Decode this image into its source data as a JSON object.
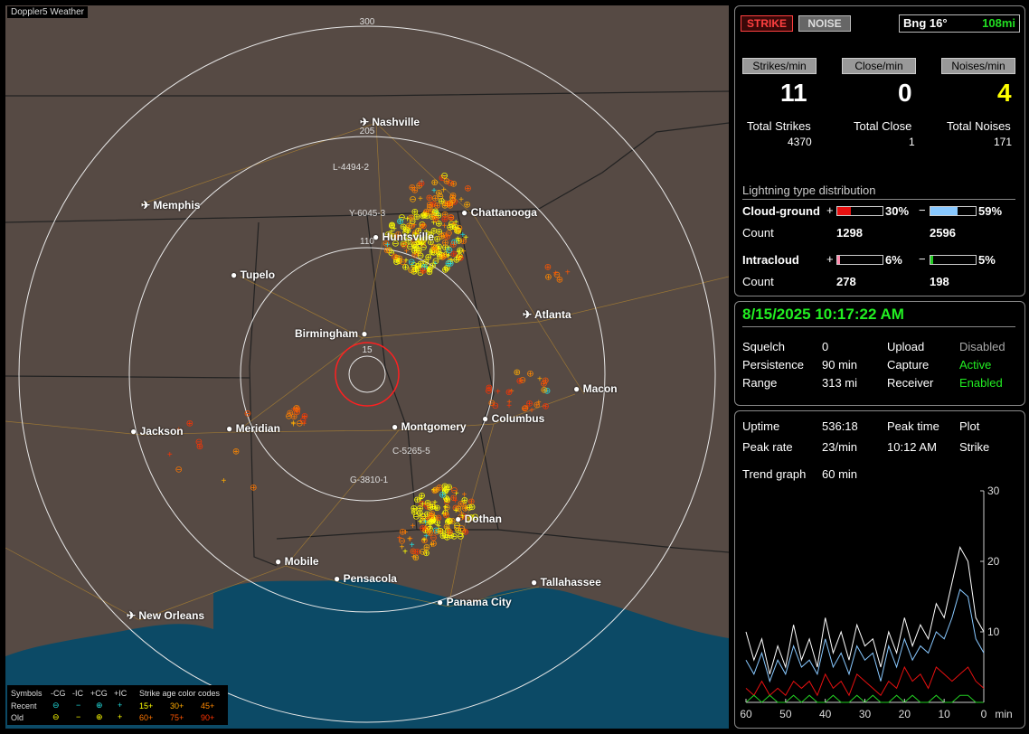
{
  "map": {
    "title": "Doppler5 Weather",
    "range_rings": [
      "300",
      "205",
      "110",
      "15"
    ],
    "cities": [
      {
        "name": "Nashville",
        "type": "airport"
      },
      {
        "name": "Memphis",
        "type": "airport"
      },
      {
        "name": "Chattanooga",
        "type": "city"
      },
      {
        "name": "Huntsville",
        "type": "city"
      },
      {
        "name": "Tupelo",
        "type": "city"
      },
      {
        "name": "Atlanta",
        "type": "airport"
      },
      {
        "name": "Birmingham",
        "type": "city"
      },
      {
        "name": "Macon",
        "type": "city"
      },
      {
        "name": "Jackson",
        "type": "city"
      },
      {
        "name": "Meridian",
        "type": "city"
      },
      {
        "name": "Montgomery",
        "type": "city"
      },
      {
        "name": "Columbus",
        "type": "city"
      },
      {
        "name": "Dothan",
        "type": "city"
      },
      {
        "name": "Mobile",
        "type": "city"
      },
      {
        "name": "Pensacola",
        "type": "city"
      },
      {
        "name": "Tallahassee",
        "type": "city"
      },
      {
        "name": "Panama City",
        "type": "city"
      },
      {
        "name": "New Orleans",
        "type": "airport"
      }
    ],
    "cell_labels": [
      "L-4494-2",
      "Y-6045-3",
      "C-5265-5",
      "G-3810-1"
    ],
    "legend": {
      "title_symbols": "Symbols",
      "cols": [
        "-CG",
        "-IC",
        "+CG",
        "+IC"
      ],
      "age_title": "Strike age color codes",
      "recent_label": "Recent",
      "old_label": "Old",
      "recent_ages": [
        "15+",
        "30+",
        "45+"
      ],
      "old_ages": [
        "60+",
        "75+",
        "90+"
      ],
      "age_colors": [
        "#ffff00",
        "#ffaa00",
        "#ff8800",
        "#ff7700",
        "#ff5500",
        "#ff3300"
      ]
    }
  },
  "panel1": {
    "strike_button": "STRIKE",
    "noise_button": "NOISE",
    "bearing": "Bng 16°",
    "distance": "108mi",
    "strikes_per_min_label": "Strikes/min",
    "close_per_min_label": "Close/min",
    "noises_per_min_label": "Noises/min",
    "strikes_per_min": "11",
    "close_per_min": "0",
    "noises_per_min": "4",
    "total_strikes_label": "Total Strikes",
    "total_close_label": "Total Close",
    "total_noises_label": "Total Noises",
    "total_strikes": "4370",
    "total_close": "1",
    "total_noises": "171",
    "dist_title": "Lightning type distribution",
    "cg_label": "Cloud-ground",
    "ic_label": "Intracloud",
    "count_label": "Count",
    "plus": "+",
    "minus": "−",
    "cg_pos_pct": "30%",
    "cg_neg_pct": "59%",
    "cg_pos_count": "1298",
    "cg_neg_count": "2596",
    "ic_pos_pct": "6%",
    "ic_neg_pct": "5%",
    "ic_pos_count": "278",
    "ic_neg_count": "198",
    "bars": {
      "cg_pos": 0.3,
      "cg_neg": 0.59,
      "ic_pos": 0.06,
      "ic_neg": 0.05
    },
    "colors": {
      "cg_pos": "#e81010",
      "cg_neg": "#88c8ff",
      "ic_pos": "#ff88aa",
      "ic_neg": "#22cc22"
    }
  },
  "panel2": {
    "datetime": "8/15/2025 10:17:22 AM",
    "squelch_label": "Squelch",
    "squelch": "0",
    "persistence_label": "Persistence",
    "persistence": "90 min",
    "range_label": "Range",
    "range": "313 mi",
    "upload_label": "Upload",
    "upload": "Disabled",
    "capture_label": "Capture",
    "capture": "Active",
    "receiver_label": "Receiver",
    "receiver": "Enabled"
  },
  "panel3": {
    "uptime_label": "Uptime",
    "uptime": "536:18",
    "peak_time_label": "Peak time",
    "peak_time": "10:12 AM",
    "plot_label": "Plot",
    "plot": "Strike",
    "peak_rate_label": "Peak rate",
    "peak_rate": "23/min",
    "trend_label": "Trend graph",
    "trend": "60 min"
  },
  "chart_data": {
    "type": "line",
    "title": "",
    "xlabel": "min",
    "ylabel": "",
    "x_ticks": [
      "60",
      "50",
      "40",
      "30",
      "20",
      "10",
      "0"
    ],
    "y_ticks": [
      "30",
      "20",
      "10"
    ],
    "xlim": [
      60,
      0
    ],
    "ylim": [
      0,
      30
    ],
    "x": [
      60,
      58,
      56,
      54,
      52,
      50,
      48,
      46,
      44,
      42,
      40,
      38,
      36,
      34,
      32,
      30,
      28,
      26,
      24,
      22,
      20,
      18,
      16,
      14,
      12,
      10,
      8,
      6,
      4,
      2,
      0
    ],
    "series": [
      {
        "color": "#ffffff",
        "values": [
          10,
          6,
          9,
          4,
          8,
          5,
          11,
          6,
          9,
          5,
          12,
          7,
          10,
          6,
          11,
          8,
          9,
          5,
          10,
          7,
          12,
          8,
          11,
          9,
          14,
          12,
          17,
          22,
          20,
          12,
          10
        ]
      },
      {
        "color": "#88c8ff",
        "values": [
          6,
          4,
          7,
          3,
          6,
          4,
          8,
          5,
          6,
          4,
          9,
          5,
          7,
          4,
          8,
          6,
          7,
          3,
          8,
          5,
          9,
          6,
          8,
          7,
          10,
          9,
          12,
          16,
          15,
          9,
          7
        ]
      },
      {
        "color": "#e81010",
        "values": [
          2,
          1,
          3,
          1,
          2,
          1,
          3,
          2,
          3,
          1,
          4,
          2,
          3,
          1,
          4,
          3,
          2,
          1,
          3,
          2,
          5,
          3,
          4,
          2,
          5,
          4,
          3,
          4,
          5,
          3,
          2
        ]
      },
      {
        "color": "#22cc22",
        "values": [
          0,
          1,
          0,
          1,
          0,
          0,
          1,
          0,
          1,
          0,
          0,
          1,
          0,
          0,
          1,
          0,
          1,
          0,
          0,
          1,
          0,
          1,
          0,
          0,
          1,
          0,
          0,
          1,
          1,
          0,
          0
        ]
      }
    ]
  }
}
